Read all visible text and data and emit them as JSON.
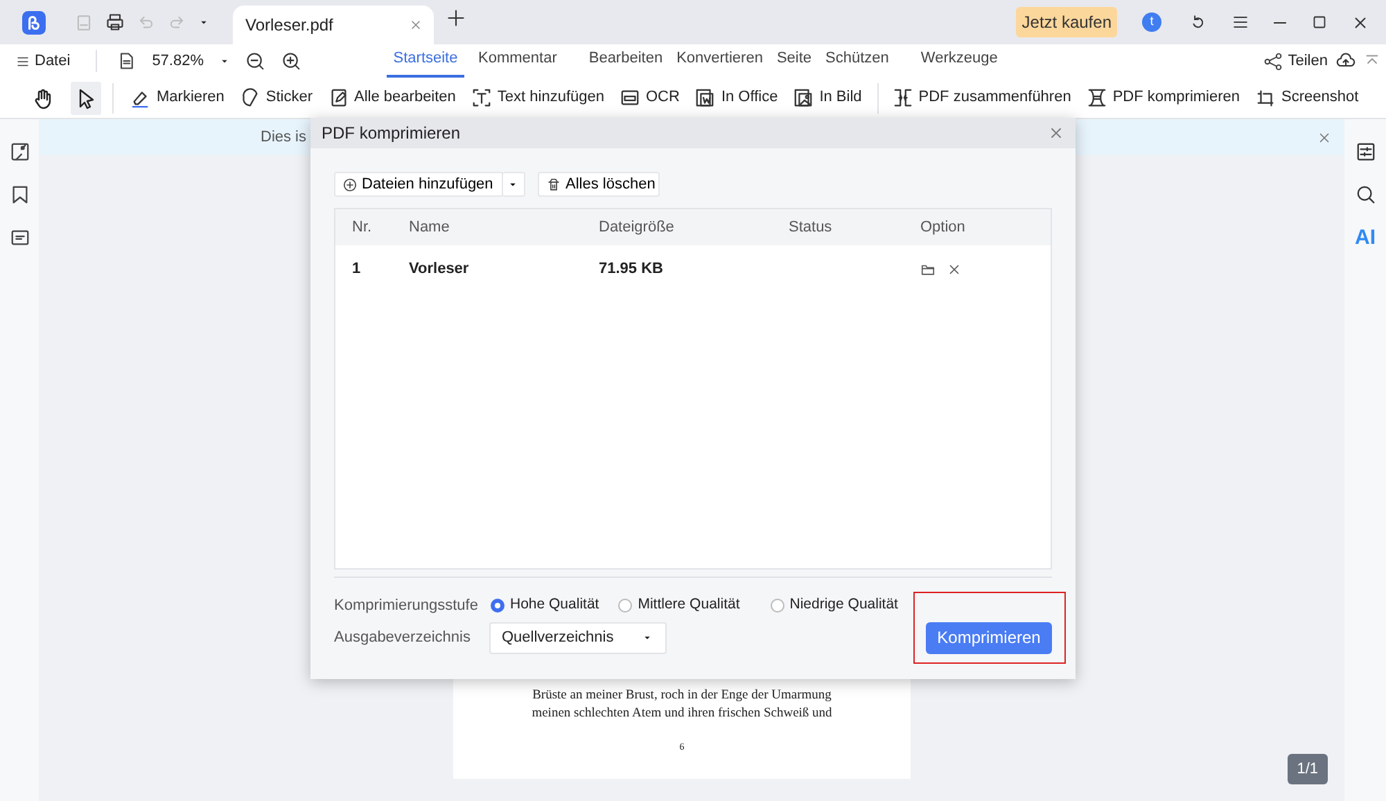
{
  "title_bar": {
    "tabs": [
      {
        "label": "Vorleser.pdf",
        "selected": true
      }
    ],
    "buy_button": "Jetzt kaufen",
    "avatar": "t"
  },
  "menu_bar": {
    "file_menu": "Datei",
    "zoom": "57.82%",
    "ribbon_tabs": [
      {
        "label": "Startseite",
        "selected": true
      },
      {
        "label": "Kommentar",
        "selected": false
      },
      {
        "label": "Bearbeiten",
        "selected": false
      },
      {
        "label": "Konvertieren",
        "selected": false
      },
      {
        "label": "Seite",
        "selected": false
      },
      {
        "label": "Schützen",
        "selected": false
      },
      {
        "label": "Werkzeuge",
        "selected": false
      }
    ],
    "share": "Teilen"
  },
  "toolbar": {
    "modes": [
      {
        "selected": false
      },
      {
        "selected": true
      }
    ],
    "tool_groups": [
      [
        {
          "label": "Markieren"
        },
        {
          "label": "Sticker"
        },
        {
          "label": "Alle bearbeiten"
        },
        {
          "label": "Text hinzufügen"
        },
        {
          "label": "OCR"
        },
        {
          "label": "In Office"
        },
        {
          "label": "In Bild"
        }
      ],
      [
        {
          "label": "PDF zusammenführen"
        },
        {
          "label": "PDF komprimieren"
        },
        {
          "label": "Screenshot"
        }
      ]
    ]
  },
  "banner": {
    "text": "Dies is"
  },
  "right_sidebar": {
    "ai_label": "AI"
  },
  "document": {
    "lines": [
      "Brüste an meiner Brust, roch in der Enge der Umarmung",
      "meinen schlechten Atem und ihren frischen Schweiß und"
    ],
    "page_number": "6",
    "page_counter": "1/1"
  },
  "dialog": {
    "title": "PDF komprimieren",
    "add_files": "Dateien hinzufügen",
    "clear_all": "Alles löschen",
    "table": {
      "columns": [
        "Nr.",
        "Name",
        "Dateigröße",
        "Status",
        "Option"
      ],
      "rows": [
        {
          "nr": "1",
          "name": "Vorleser",
          "size": "71.95 KB"
        }
      ]
    },
    "level_label": "Komprimierungsstufe",
    "levels": [
      {
        "label": "Hohe Qualität",
        "selected": true
      },
      {
        "label": "Mittlere Qualität",
        "selected": false
      },
      {
        "label": "Niedrige Qualität",
        "selected": false
      }
    ],
    "output_label": "Ausgabeverzeichnis",
    "output_value": "Quellverzeichnis",
    "compress_button": {
      "label": "Komprimieren",
      "highlighted": true
    }
  }
}
